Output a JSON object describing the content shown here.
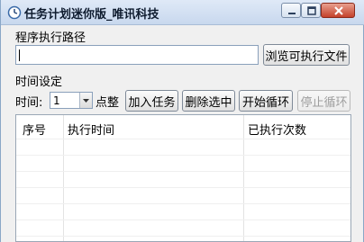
{
  "window": {
    "title": "任务计划迷你版_唯讯科技",
    "controls": [
      "minimize-icon",
      "maximize-icon",
      "close-icon"
    ]
  },
  "path_section": {
    "label": "程序执行路径",
    "input_value": "",
    "browse_button": "浏览可执行文件"
  },
  "time_section": {
    "label": "时间设定",
    "time_label": "时间:",
    "hour_value": "1",
    "hour_suffix": "点整",
    "add_button": "加入任务",
    "delete_button": "删除选中",
    "start_button": "开始循环",
    "stop_button": "停止循环"
  },
  "table": {
    "columns": [
      "序号",
      "执行时间",
      "已执行次数"
    ],
    "rows": []
  },
  "colors": {
    "titlebar_top": "#dfe9f7",
    "titlebar_bottom": "#c8d8ee",
    "window_bg": "#f0f0f0",
    "close_button": "#c4412b"
  }
}
